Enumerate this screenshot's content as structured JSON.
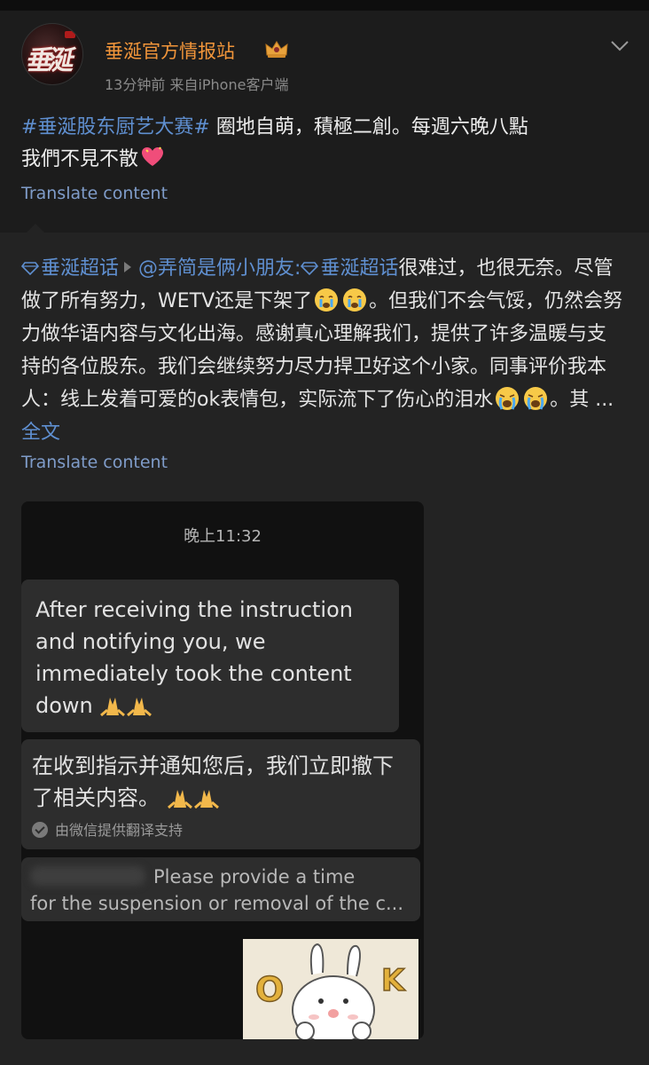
{
  "post": {
    "username": "垂涎官方情报站",
    "meta": "13分钟前  来自iPhone客户端",
    "hashtag": "#垂涎股东厨艺大赛#",
    "text_line1": " 圈地自萌，積極二創。每週六晚八點",
    "text_line2": "我們不見不散",
    "translate": "Translate content"
  },
  "repost": {
    "tag1": "垂涎超话",
    "mention": "@弄简是俩小朋友:",
    "tag2": "垂涎超话",
    "seg1": "很难过，也很无奈。尽管做了所有努力，WETV还是下架了",
    "seg2": "。但我们不会气馁，仍然会努力做华语内容与文化出海。感谢真心理解我们，提供了许多温暖与支持的各位股东。我们会继续努力尽力捍卫好这个小家。同事评价我本人：线上发着可爱的ok表情包，实际流下了伤心的泪水",
    "seg3": "。其 ...",
    "full": "全文",
    "translate": "Translate content"
  },
  "screenshot": {
    "time": "晚上11:32",
    "msg1": "After receiving the instruction and notifying you, we immediately took the content down",
    "msg2": "在收到指示并通知您后，我们立即撤下了相关内容。",
    "msg2_note": "由微信提供翻译支持",
    "msg3_line1": "Please provide a time",
    "msg3_line2": "for the suspension or removal of the c...",
    "sticker_text": "O K"
  },
  "colors": {
    "username": "#f1953a",
    "link_blue": "#5f8fd0",
    "background": "#151515"
  }
}
